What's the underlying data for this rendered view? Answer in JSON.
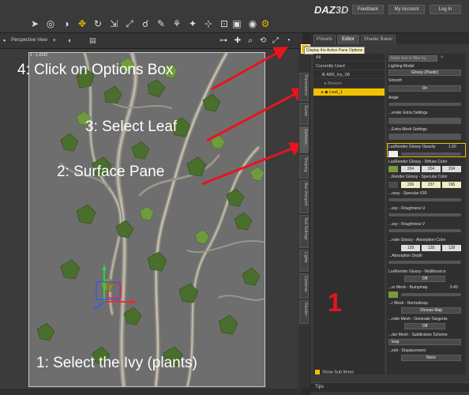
{
  "app": {
    "logo": "DAZ",
    "logo_suffix": "3D",
    "header_buttons": [
      "Feedback",
      "My Account",
      "Log In"
    ]
  },
  "viewport": {
    "view_label": "Perspective View",
    "zoom_label": "1 : 1.4142"
  },
  "annotations": {
    "step1": "1: Select the Ivy (plants)",
    "step2": "2: Surface Pane",
    "step3": "3: Select Leaf",
    "step4": "4: Click on Options Box",
    "big_number": "1"
  },
  "side_tabs": [
    "Parameters",
    "Scene",
    "Surfaces",
    "Shaping",
    "Aux Viewport",
    "Tool Settings",
    "Lights",
    "Cameras",
    "Render"
  ],
  "pane": {
    "tabs": [
      "Presets",
      "Editor",
      "Shader Baker"
    ],
    "active_tab": "Editor",
    "options_tooltip": "Display the Active Pane Options",
    "tree": [
      "All",
      "Currently Used",
      "AB5_Ivy_08",
      "Branch",
      "Leaf_1"
    ],
    "selected_item": "Leaf_1",
    "search_placeholder": "Enter text to filter by",
    "properties": {
      "lighting_model_label": "Lighting Model",
      "lighting_model_value": "Glossy (Plastic)",
      "smooth_label": "Smooth",
      "smooth_value": "On",
      "angle_label": "Angle",
      "render_extra_label": "...ender Extra Settings",
      "extra_mesh_label": "...Extra Mesh Settings",
      "opacity_label": "LuxRender Glossy Opacity",
      "opacity_value": "1.00",
      "diffuse_label": "LuxRender Glossy - Diffuse Color",
      "diffuse_rgb": [
        "204",
        "204",
        "204"
      ],
      "specular_label": "...Render Glossy - Specular Color",
      "specular_rgb": [
        "236",
        "237",
        "196"
      ],
      "ior_label": "...ossy - Specular IOR",
      "rough_u_label": "...ssy - Roughness U",
      "rough_v_label": "...ssy - Roughness V",
      "absorption_label": "...nder Glossy - Absorption Color",
      "absorption_rgb": [
        "128",
        "128",
        "128"
      ],
      "abs_depth_label": "...Absorption Depth",
      "multibounce_label": "LuxRender Glossy - Multibounce",
      "multibounce_value": "Off",
      "bumpmap_label": "...er Mesh - Bumpmap",
      "bumpmap_value": "0.49",
      "normalmap_label": "...r Mesh - Normalmap",
      "normalmap_value": "Choose Map",
      "tangents_label": "...nder Mesh - Generate Tangents",
      "tangents_value": "Off",
      "subdiv_label": "...der Mesh - Subdivision Scheme",
      "subdiv_value": "loop",
      "displacement_label": "...esh - Displacement",
      "displacement_value": "None"
    },
    "show_sub_items": "Show Sub Items",
    "tips": "Tips"
  }
}
